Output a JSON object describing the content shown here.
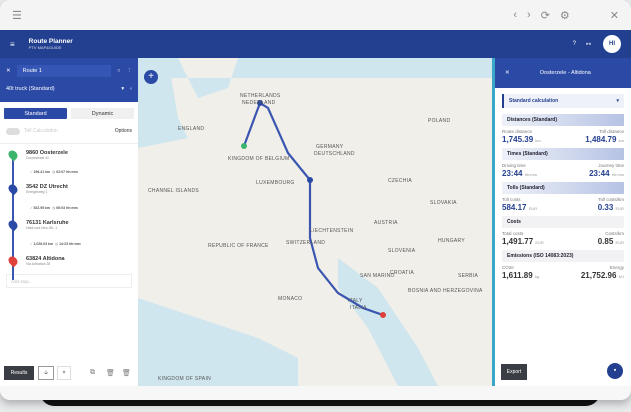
{
  "browser": {
    "menu_icon": "hamburger-icon",
    "nav": [
      "‹",
      "›",
      "⟳",
      "⚙"
    ],
    "close": "✕"
  },
  "app": {
    "title": "Route Planner",
    "subtitle": "PTV MAP&GUIDE",
    "help": "?",
    "link": "⚯",
    "avatar": "HI"
  },
  "route": {
    "name": "Route 1",
    "vehicle": "40t truck (Standard)",
    "modes": [
      "Standard",
      "Dynamic"
    ],
    "toggle_label": "Toll Calculation",
    "options": "Options",
    "stops": [
      {
        "num": "1",
        "name": "9860 Oosterzele",
        "addr": "Dorpsstraat 41",
        "color": "#3bb56b"
      },
      {
        "num": "2",
        "name": "3542 DZ Utrecht",
        "addr": "Energieweg 1",
        "color": "#2b4aa6"
      },
      {
        "num": "3",
        "name": "76131 Karlsruhe",
        "addr": "Haid-und-Neu-Str. 1",
        "color": "#2b4aa6"
      },
      {
        "num": "4",
        "name": "63824 Altidona",
        "addr": "Via Adriatica 28",
        "color": "#e0403a"
      }
    ],
    "legs": [
      {
        "dist": "196.41 km",
        "time": "02:07 hh:mm"
      },
      {
        "dist": "522.95 km",
        "time": "06:03 hh:mm"
      },
      {
        "dist": "1,026.03 km",
        "time": "14:23 hh:mm"
      }
    ],
    "add_placeholder": "Add stop...",
    "results": "Results"
  },
  "map": {
    "labels": [
      "ENGLAND",
      "NETHERLANDS",
      "NEDERLAND",
      "KINGDOM OF BELGIUM",
      "GERMANY",
      "DEUTSCHLAND",
      "LUXEMBOURG",
      "CZECHIA",
      "POLAND",
      "CHANNEL ISLANDS",
      "REPUBLIC OF FRANCE",
      "SWITZERLAND",
      "LIECHTENSTEIN",
      "AUSTRIA",
      "SLOVAKIA",
      "HUNGARY",
      "SLOVENIA",
      "CROATIA",
      "BOSNIA AND HERZEGOVINA",
      "SERBIA",
      "ITALY",
      "ITALIA",
      "MONACO",
      "SAN MARINO",
      "KINGDOM OF SPAIN"
    ],
    "zoom_in": "+"
  },
  "panel": {
    "title": "Oosterzele - Altidona",
    "calc": "Standard calculation",
    "distances": {
      "title": "Distances (Standard)",
      "l1": "Route distance",
      "l2": "Toll distance",
      "v1": "1,745.39",
      "u1": "km",
      "v2": "1,484.79",
      "u2": "km"
    },
    "times": {
      "title": "Times (Standard)",
      "l1": "Driving time",
      "l2": "Journey time",
      "v1": "23:44",
      "u1": "hh:mm",
      "v2": "23:44",
      "u2": "hh:mm"
    },
    "tolls": {
      "title": "Tolls (Standard)",
      "l1": "Toll costs",
      "l2": "Toll costs/km",
      "v1": "584.17",
      "u1": "EUR",
      "v2": "0.33",
      "u2": "EUR"
    },
    "costs": {
      "title": "Costs",
      "l1": "Total costs",
      "l2": "Costs/km",
      "v1": "1,491.77",
      "u1": "EUR",
      "v2": "0.85",
      "u2": "EUR"
    },
    "emissions": {
      "title": "Emissions (ISO 14083:2023)",
      "l1": "CO2e",
      "l2": "Energy",
      "v1": "1,611.89",
      "u1": "kg",
      "v2": "21,752.96",
      "u2": "MJ"
    },
    "export": "Export"
  },
  "colors": {
    "primary": "#233f8f",
    "accent": "#3aa6c8",
    "route": "#3a56b0"
  }
}
